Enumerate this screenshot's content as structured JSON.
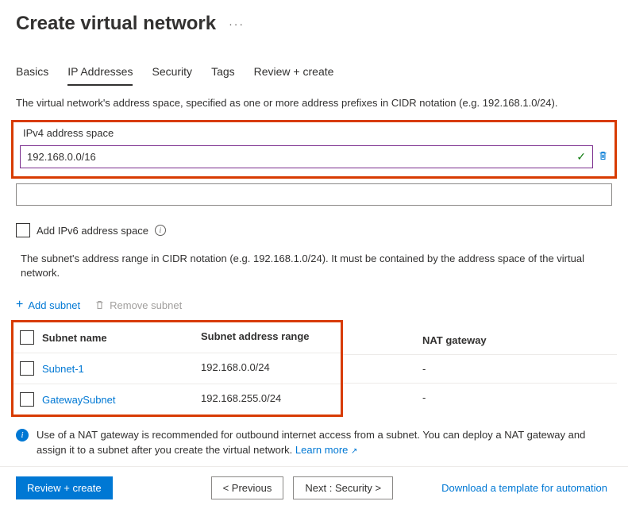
{
  "header": {
    "title": "Create virtual network"
  },
  "tabs": {
    "basics": "Basics",
    "ip": "IP Addresses",
    "security": "Security",
    "tags": "Tags",
    "review": "Review + create"
  },
  "address_space": {
    "description": "The virtual network's address space, specified as one or more address prefixes in CIDR notation (e.g. 192.168.1.0/24).",
    "label": "IPv4 address space",
    "value": "192.168.0.0/16"
  },
  "ipv6": {
    "label": "Add IPv6 address space"
  },
  "subnet": {
    "description": "The subnet's address range in CIDR notation (e.g. 192.168.1.0/24). It must be contained by the address space of the virtual network.",
    "add_label": "Add subnet",
    "remove_label": "Remove subnet",
    "columns": {
      "name": "Subnet name",
      "range": "Subnet address range",
      "nat": "NAT gateway"
    },
    "rows": [
      {
        "name": "Subnet-1",
        "range": "192.168.0.0/24",
        "nat": "-"
      },
      {
        "name": "GatewaySubnet",
        "range": "192.168.255.0/24",
        "nat": "-"
      }
    ]
  },
  "info": {
    "text": "Use of a NAT gateway is recommended for outbound internet access from a subnet. You can deploy a NAT gateway and assign it to a subnet after you create the virtual network. ",
    "learn_more": "Learn more"
  },
  "footer": {
    "review": "Review + create",
    "previous": "< Previous",
    "next": "Next : Security >",
    "download": "Download a template for automation"
  }
}
